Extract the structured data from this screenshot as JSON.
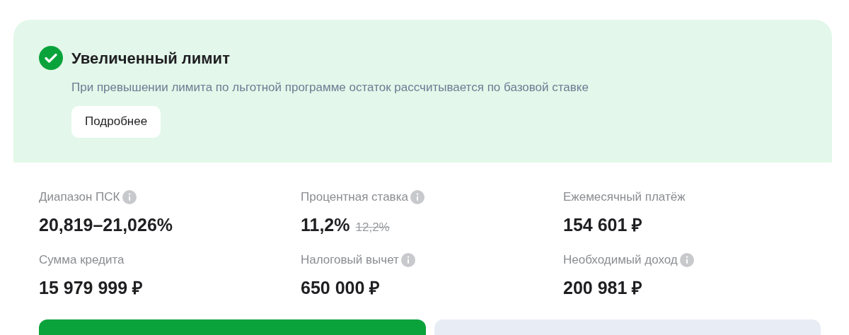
{
  "banner": {
    "title": "Увеличенный лимит",
    "description": "При превышении лимита по льготной программе остаток рассчитывается по базовой ставке",
    "button": "Подробнее"
  },
  "stats": [
    {
      "label": "Диапазон ПСК",
      "info": true,
      "value": "20,819–21,026%"
    },
    {
      "label": "Процентная ставка",
      "info": true,
      "value": "11,2%",
      "old_value": "12,2%"
    },
    {
      "label": "Ежемесячный платёж",
      "info": false,
      "value": "154 601 ₽"
    },
    {
      "label": "Сумма кредита",
      "info": false,
      "value": "15 979 999 ₽"
    },
    {
      "label": "Налоговый вычет",
      "info": true,
      "value": "650 000 ₽"
    },
    {
      "label": "Необходимый доход",
      "info": true,
      "value": "200 981 ₽"
    }
  ],
  "actions": [
    {
      "kind": "primary"
    },
    {
      "kind": "secondary"
    }
  ]
}
